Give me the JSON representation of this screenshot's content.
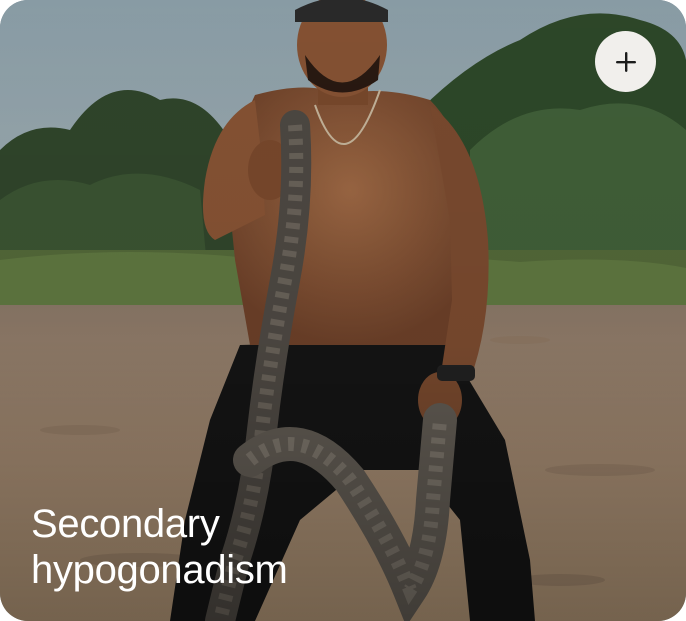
{
  "card": {
    "title_line_1": "Secondary",
    "title_line_2": "hypogonadism",
    "add_button_icon": "plus-icon",
    "image_subject": "shirtless man training with battle ropes outdoors"
  },
  "colors": {
    "title_text": "#ffffff",
    "add_button_bg": "#f1efec",
    "add_button_icon": "#1c1c1c",
    "sky": "#8ea1aa",
    "foliage": "#3d5a33",
    "sand": "#a98d72"
  }
}
